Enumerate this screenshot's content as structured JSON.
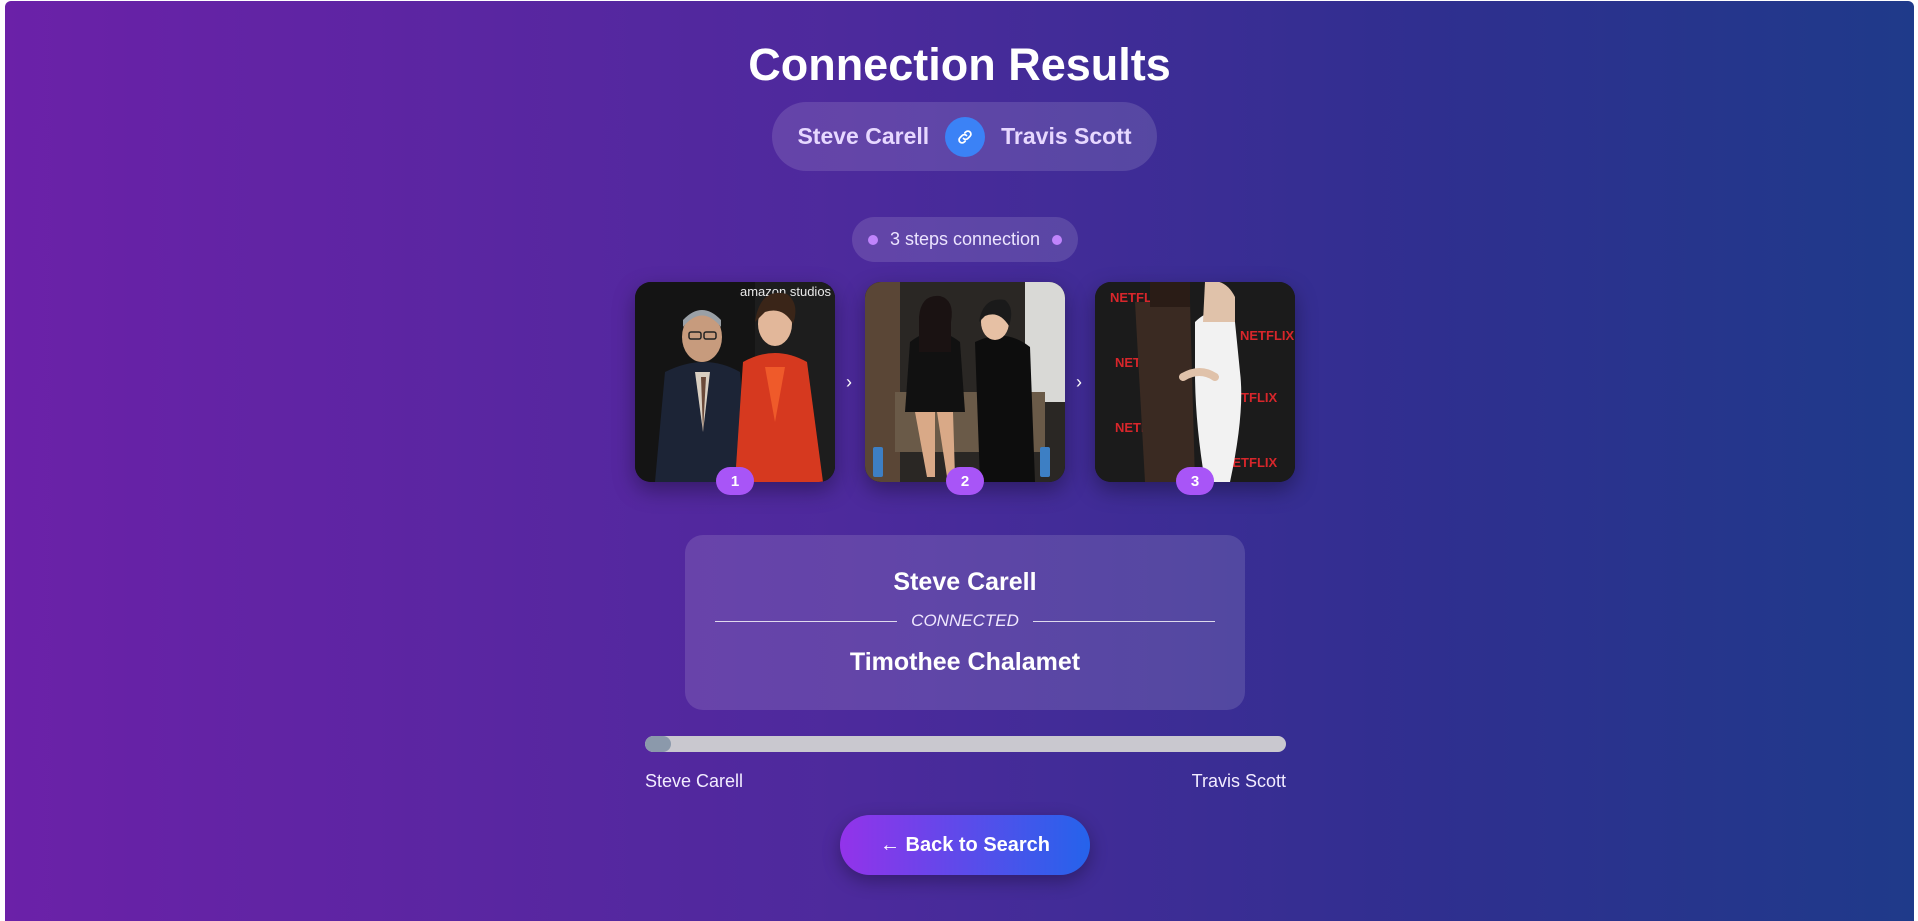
{
  "page": {
    "title": "Connection Results"
  },
  "pair": {
    "from": "Steve Carell",
    "to": "Travis Scott",
    "icon": "link-icon"
  },
  "steps": {
    "label": "3 steps connection",
    "items": [
      {
        "number": "1",
        "photo": "photo-steve-carell-timothee-chalamet",
        "backdrop_text": "amazon studios"
      },
      {
        "number": "2",
        "photo": "photo-kylie-jenner-timothee-chalamet",
        "backdrop_text": ""
      },
      {
        "number": "3",
        "photo": "photo-travis-scott-kylie-jenner",
        "backdrop_text": "NETFLIX"
      }
    ],
    "arrow_icon": "chevron-right-icon"
  },
  "connection_card": {
    "person_a": "Steve Carell",
    "connector": "CONNECTED",
    "person_b": "Timothee Chalamet"
  },
  "progress": {
    "value_fraction": 0.04,
    "start_label": "Steve Carell",
    "end_label": "Travis Scott"
  },
  "actions": {
    "back_label": "← Back to Search"
  },
  "colors": {
    "accent_purple": "#a855f7",
    "link_blue": "#3b82f6",
    "bg_left": "#6b21a8",
    "bg_right": "#1f3a8a"
  }
}
